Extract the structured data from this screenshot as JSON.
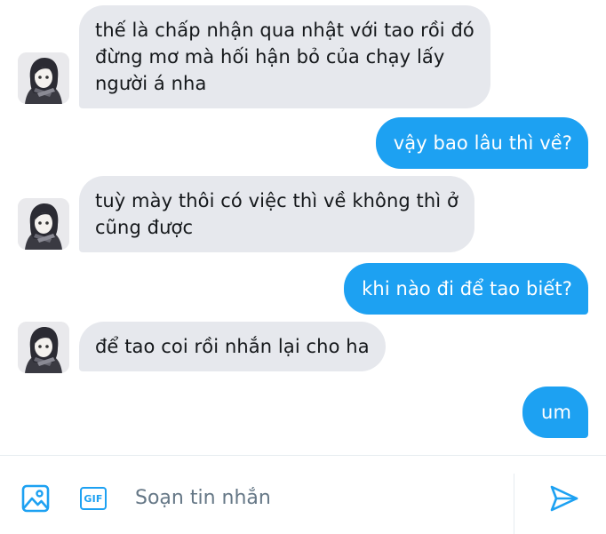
{
  "conversation": {
    "messages": [
      {
        "direction": "incoming",
        "lines": [
          "thế là chấp nhận qua nhật với tao rồi đó",
          "đừng mơ mà hối hận bỏ của chạy lấy",
          "người á nha"
        ]
      },
      {
        "direction": "outgoing",
        "lines": [
          "vậy bao lâu thì về?"
        ]
      },
      {
        "direction": "incoming",
        "lines": [
          "tuỳ mày thôi có việc thì về không thì ở",
          "cũng được"
        ]
      },
      {
        "direction": "outgoing",
        "lines": [
          "khi nào đi để tao biết?"
        ]
      },
      {
        "direction": "incoming",
        "lines": [
          "để tao coi rồi nhắn lại cho ha"
        ]
      },
      {
        "direction": "outgoing",
        "lines": [
          "um"
        ]
      }
    ]
  },
  "composer": {
    "placeholder": "Soạn tin nhắn",
    "gif_label": "GIF",
    "icons": {
      "media": "image-icon",
      "gif": "gif-icon",
      "send": "send-icon"
    }
  },
  "colors": {
    "accent": "#1da1f2",
    "incoming_bubble": "#e6e8ed",
    "incoming_text": "#14171a",
    "outgoing_text": "#ffffff",
    "placeholder": "#657786"
  }
}
